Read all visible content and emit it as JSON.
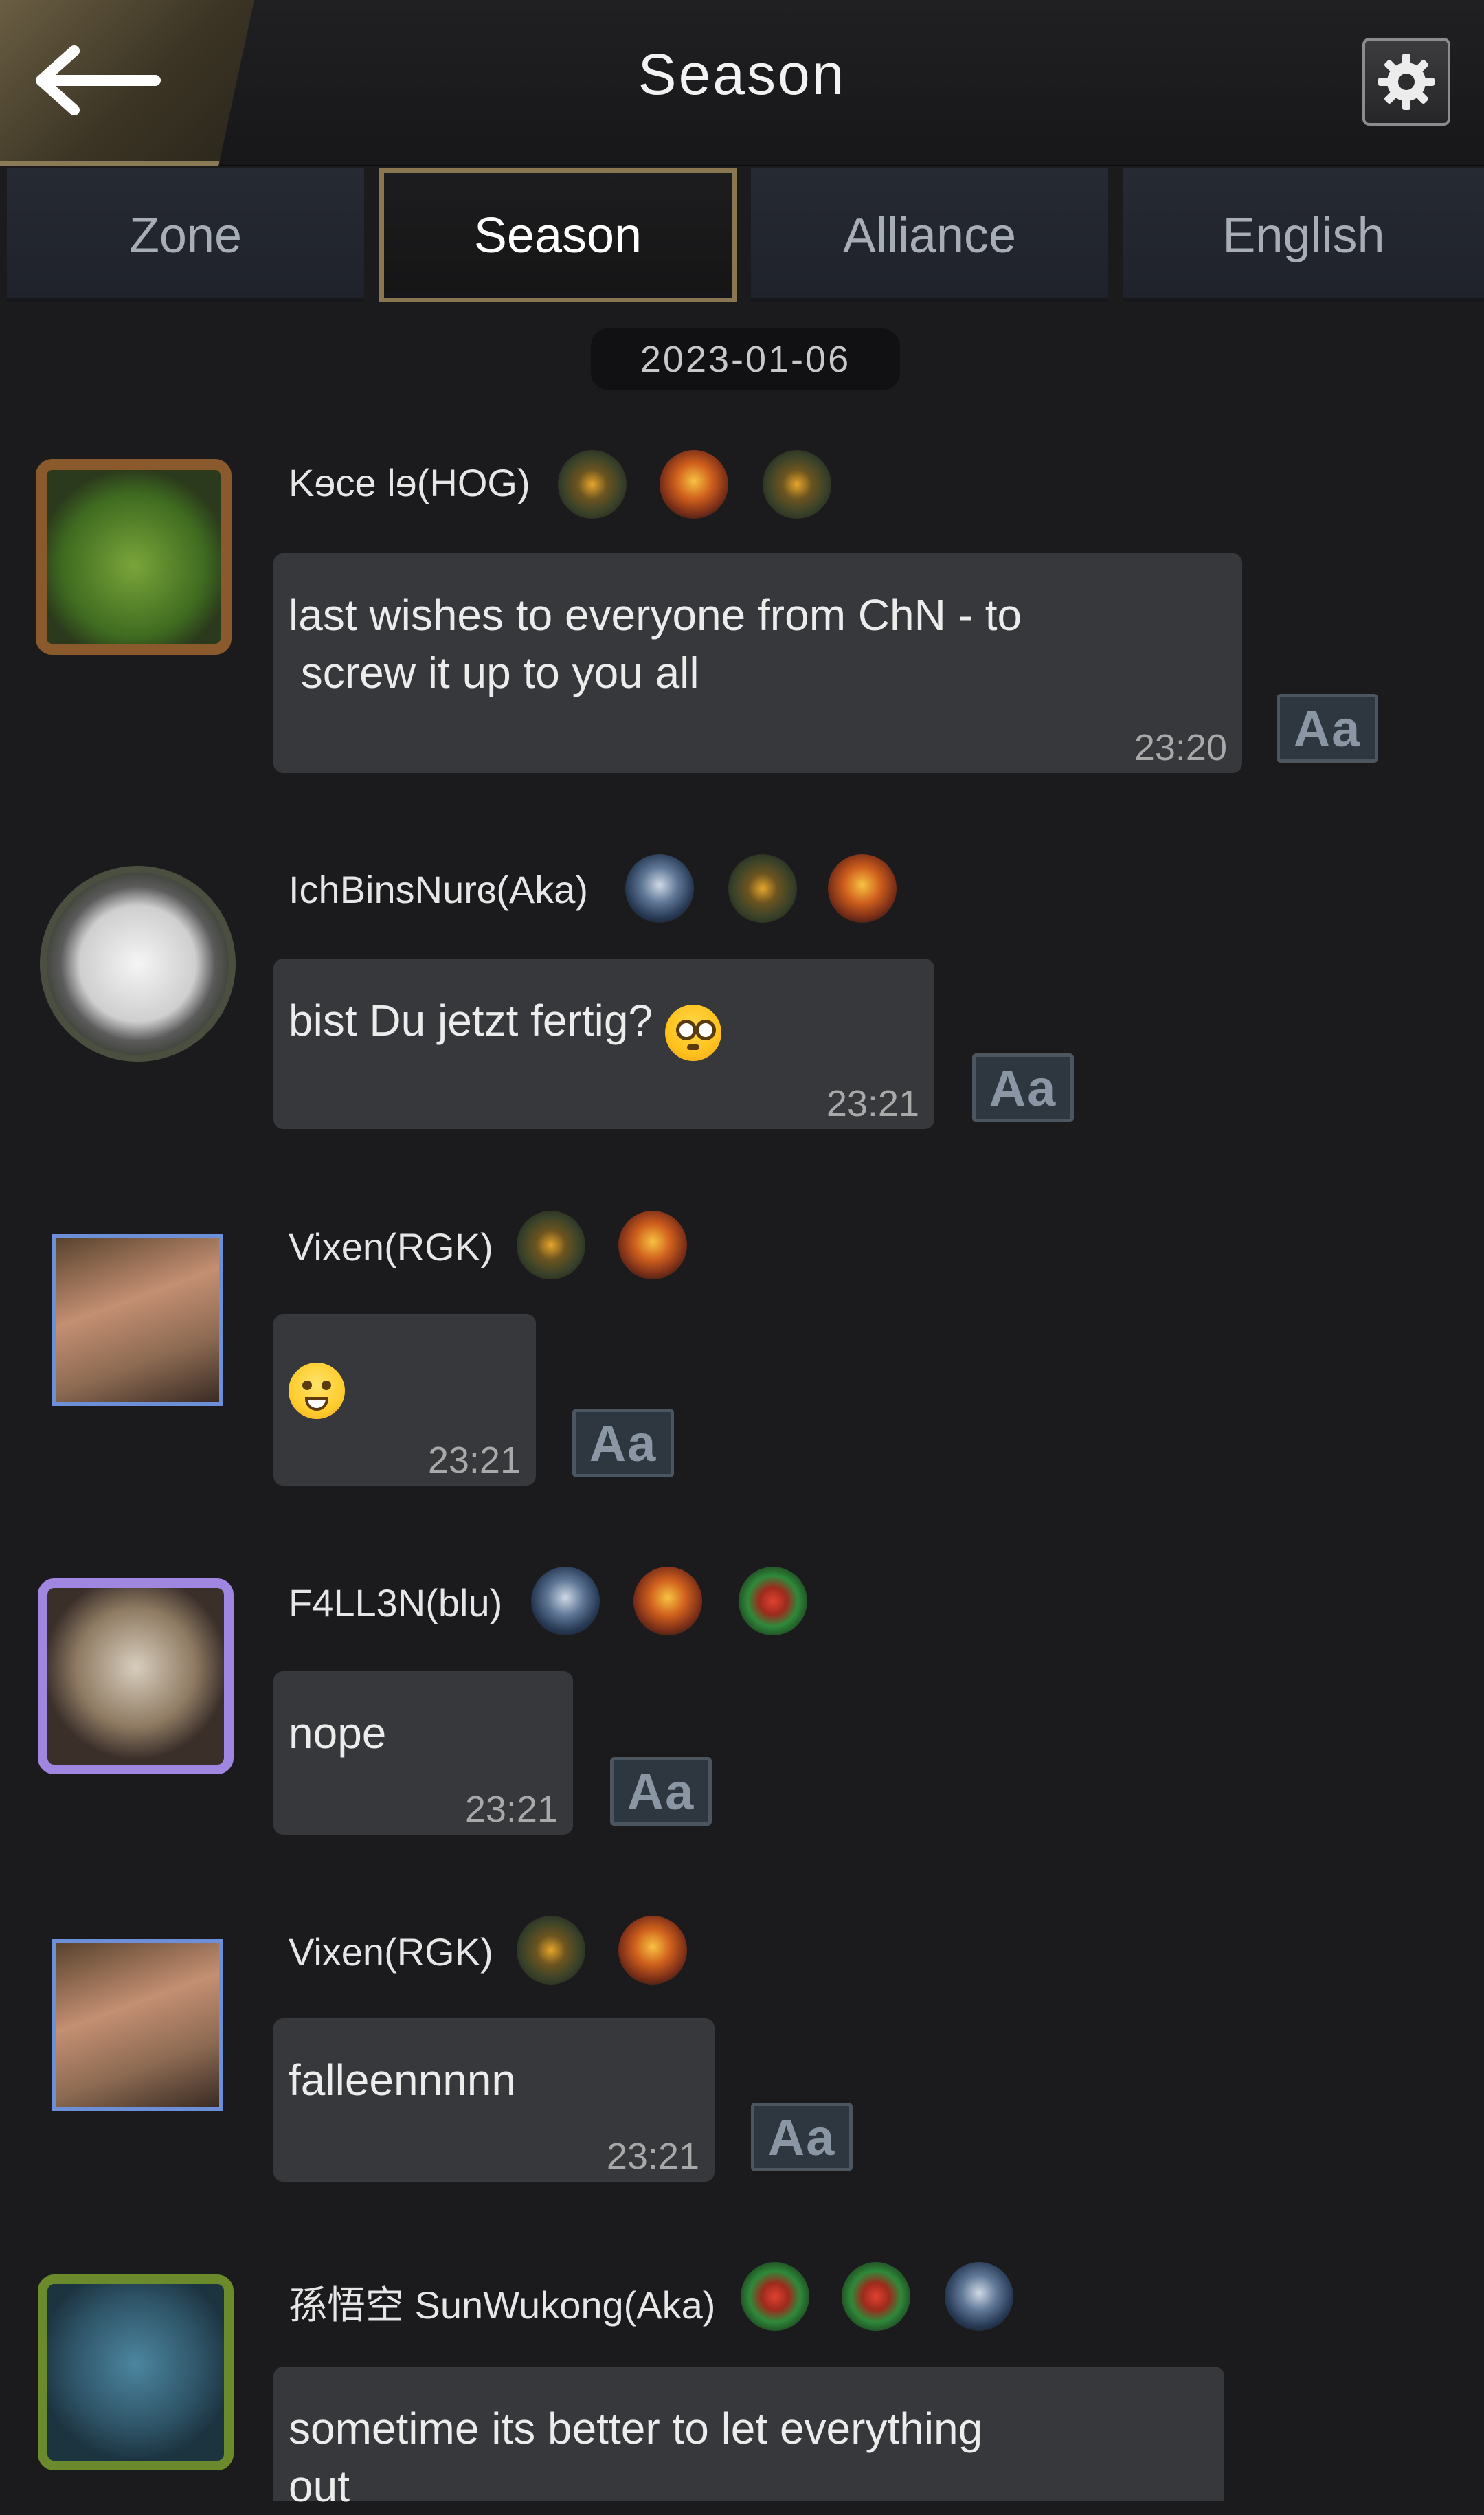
{
  "header": {
    "title": "Season",
    "back_icon": "back-arrow-icon",
    "settings_icon": "gear-icon"
  },
  "tabs": [
    {
      "label": "Zone",
      "active": false
    },
    {
      "label": "Season",
      "active": true
    },
    {
      "label": "Alliance",
      "active": false
    },
    {
      "label": "English",
      "active": false
    }
  ],
  "date_separator": "2023-01-06",
  "translate_label": "Aa",
  "messages": [
    {
      "user": "Kɘce Ɩɘ(HOG)",
      "text": "last wishes to everyone from ChN - to\n screw it up to you all",
      "time": "23:20"
    },
    {
      "user": "IchBinsNurɞ(Aka)",
      "text": "bist Du jetzt fertig?",
      "emoji": "flushed-face",
      "time": "23:21"
    },
    {
      "user": "Vixen(RGK)",
      "text": "",
      "emoji": "grinning-sweat-face",
      "time": "23:21"
    },
    {
      "user": "F4LL3N(blu)",
      "text": "nope",
      "time": "23:21"
    },
    {
      "user": "Vixen(RGK)",
      "text": "falleennnnn",
      "time": "23:21"
    },
    {
      "user": "孫悟空 SunWukong(Aka)",
      "text": "sometime its better to let everything\nout",
      "time": ""
    }
  ]
}
